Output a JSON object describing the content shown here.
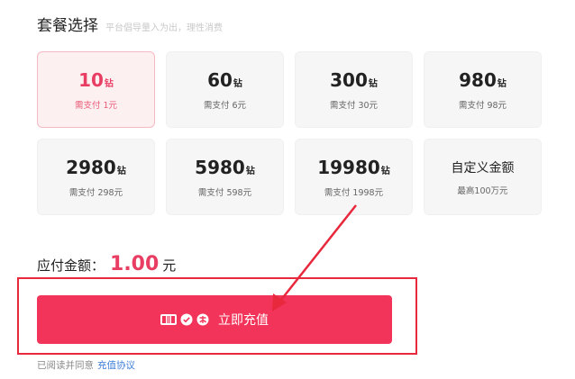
{
  "header": {
    "title": "套餐选择",
    "subtitle": "平台倡导量入为出，理性消费"
  },
  "packages": [
    {
      "amount": "10",
      "unit": "钻",
      "price": "需支付 1元",
      "selected": true
    },
    {
      "amount": "60",
      "unit": "钻",
      "price": "需支付 6元",
      "selected": false
    },
    {
      "amount": "300",
      "unit": "钻",
      "price": "需支付 30元",
      "selected": false
    },
    {
      "amount": "980",
      "unit": "钻",
      "price": "需支付 98元",
      "selected": false
    },
    {
      "amount": "2980",
      "unit": "钻",
      "price": "需支付 298元",
      "selected": false
    },
    {
      "amount": "5980",
      "unit": "钻",
      "price": "需支付 598元",
      "selected": false
    },
    {
      "amount": "19980",
      "unit": "钻",
      "price": "需支付 1998元",
      "selected": false
    }
  ],
  "custom": {
    "title": "自定义金额",
    "subtitle": "最高100万元"
  },
  "payment": {
    "label": "应付金额：",
    "value": "1.00",
    "unit": "元"
  },
  "cta": {
    "label": "立即充值",
    "icons": [
      "unionpay-icon",
      "wechat-pay-icon",
      "alipay-icon"
    ]
  },
  "agreement": {
    "text": "已阅读并同意",
    "link": "充值协议"
  },
  "colors": {
    "accent": "#f2345a",
    "price": "#e93e63",
    "annotation": "#e8283c",
    "link": "#3f7fd8"
  }
}
